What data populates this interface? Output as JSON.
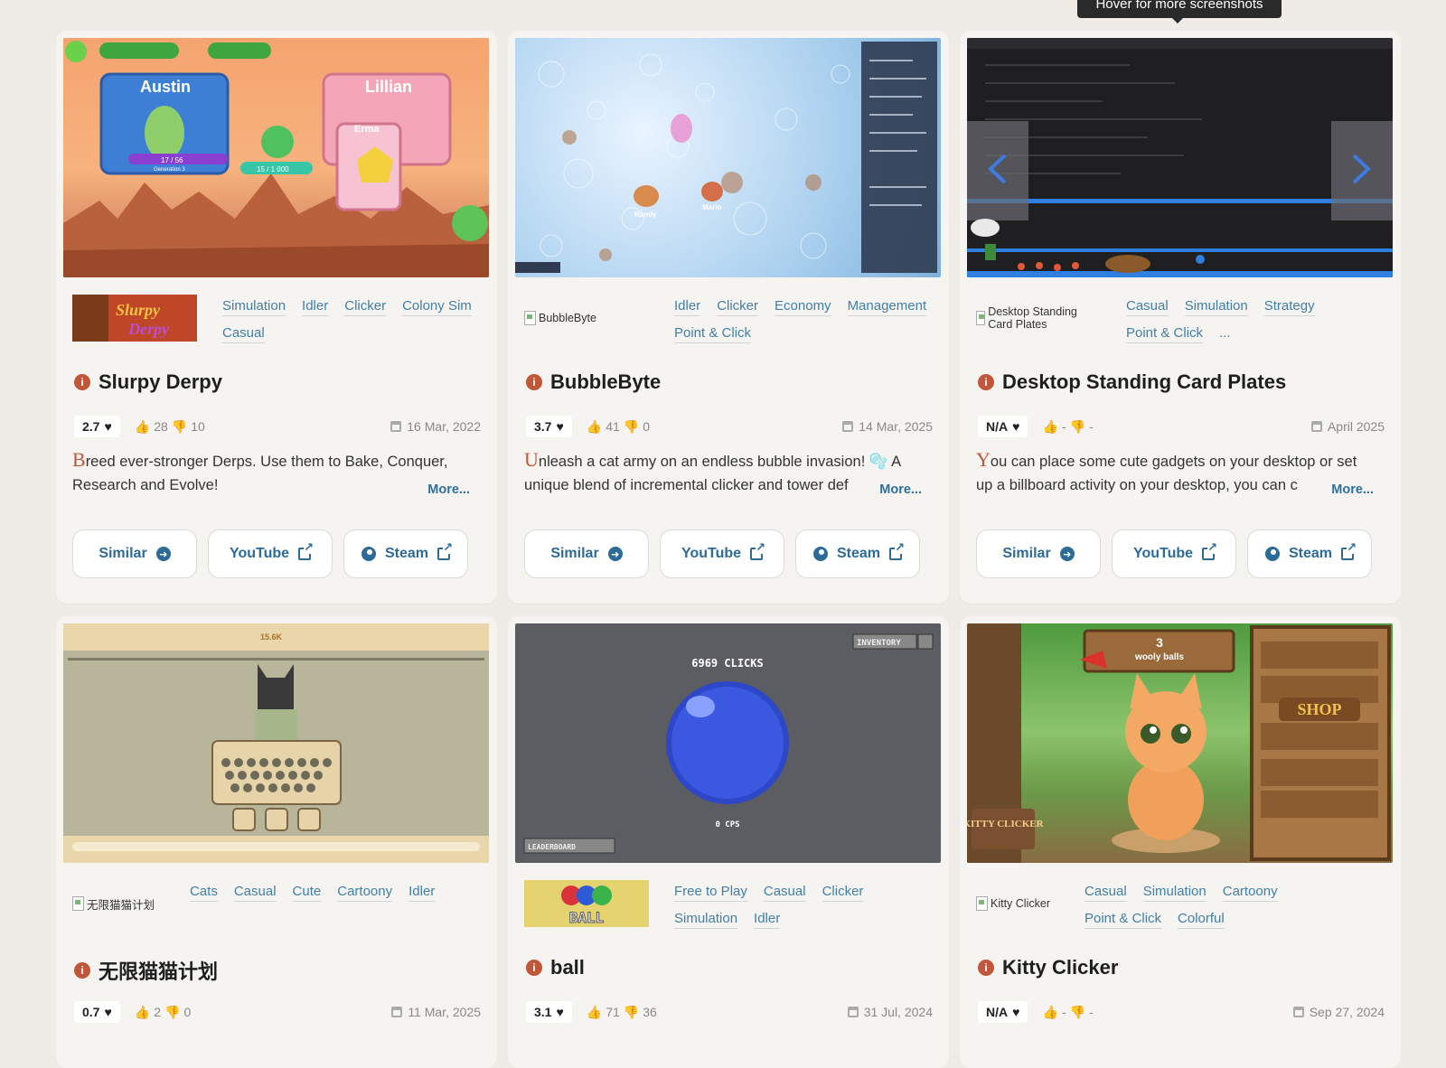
{
  "tooltip": "Hover for more screenshots",
  "buttons": {
    "similar": "Similar",
    "youtube": "YouTube",
    "steam": "Steam"
  },
  "more_label": "More...",
  "cards": [
    {
      "title": "Slurpy Derpy",
      "logo_alt": "",
      "tags": [
        "Simulation",
        "Idler",
        "Clicker",
        "Colony Sim",
        "Casual"
      ],
      "rating": "2.7",
      "likes": "28",
      "dislikes": "10",
      "date": "16 Mar, 2022",
      "desc_first": "B",
      "desc_rest": "reed ever-stronger Derps. Use them to Bake, Conquer, Research and Evolve!",
      "shot_text": [
        "Austin",
        "Lillian",
        "Erma",
        "Generation 3",
        "17 / 56",
        "15 / 1 000"
      ]
    },
    {
      "title": "BubbleByte",
      "logo_alt": "BubbleByte",
      "tags": [
        "Idler",
        "Clicker",
        "Economy",
        "Management",
        "Point & Click"
      ],
      "rating": "3.7",
      "likes": "41",
      "dislikes": "0",
      "date": "14 Mar, 2025",
      "desc_first": "U",
      "desc_rest": "nleash a cat army on an endless bubble invasion! 🫧 A unique blend of incremental clicker and tower def",
      "shot_text": [
        "Randy",
        "Mario"
      ]
    },
    {
      "title": "Desktop Standing Card Plates",
      "logo_alt": "Desktop Standing Card Plates",
      "tags": [
        "Casual",
        "Simulation",
        "Strategy",
        "Point & Click",
        "..."
      ],
      "rating": "N/A",
      "likes": "-",
      "dislikes": "-",
      "date": "April 2025",
      "desc_first": "Y",
      "desc_rest": "ou can place some cute gadgets on your desktop or set up a billboard activity on your desktop, you can c",
      "shot_text": []
    },
    {
      "title": "无限猫猫计划",
      "logo_alt": "无限猫猫计划",
      "tags": [
        "Cats",
        "Casual",
        "Cute",
        "Cartoony",
        "Idler"
      ],
      "rating": "0.7",
      "likes": "2",
      "dislikes": "0",
      "date": "11 Mar, 2025",
      "shot_text": [
        "15.6K"
      ]
    },
    {
      "title": "ball",
      "logo_alt": "BALL",
      "tags": [
        "Free to Play",
        "Casual",
        "Clicker",
        "Simulation",
        "Idler"
      ],
      "rating": "3.1",
      "likes": "71",
      "dislikes": "36",
      "date": "31 Jul, 2024",
      "shot_text": [
        "6969 CLICKS",
        "0 CPS",
        "INVENTORY",
        "LEADERBOARD"
      ]
    },
    {
      "title": "Kitty Clicker",
      "logo_alt": "Kitty Clicker",
      "tags": [
        "Casual",
        "Simulation",
        "Cartoony",
        "Point & Click",
        "Colorful"
      ],
      "rating": "N/A",
      "likes": "-",
      "dislikes": "-",
      "date": "Sep 27, 2024",
      "shot_text": [
        "3",
        "wooly balls",
        "SHOP",
        "KITTY CLICKER"
      ]
    }
  ]
}
